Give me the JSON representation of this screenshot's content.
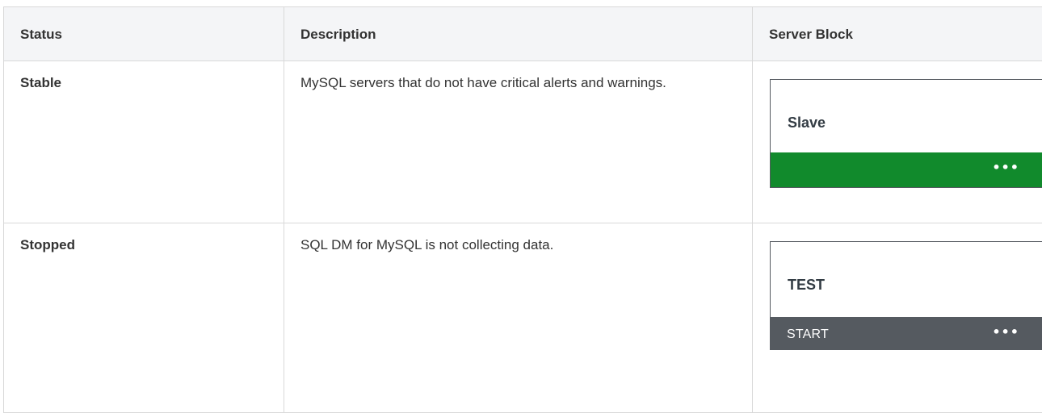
{
  "table": {
    "headers": {
      "status": "Status",
      "description": "Description",
      "server_block": "Server Block"
    },
    "rows": [
      {
        "status": "Stable",
        "description": "MySQL servers that do not have critical alerts and warnings.",
        "server_block": {
          "name": "Slave",
          "bar_label": "",
          "bar_color": "#118a2c",
          "menu_icon": "more-dots-icon",
          "menu_glyph": "•••"
        }
      },
      {
        "status": "Stopped",
        "description": "SQL DM for MySQL is not collecting data.",
        "server_block": {
          "name": "TEST",
          "bar_label": "START",
          "bar_color": "#555a60",
          "menu_icon": "more-dots-icon",
          "menu_glyph": "•••"
        }
      }
    ]
  }
}
